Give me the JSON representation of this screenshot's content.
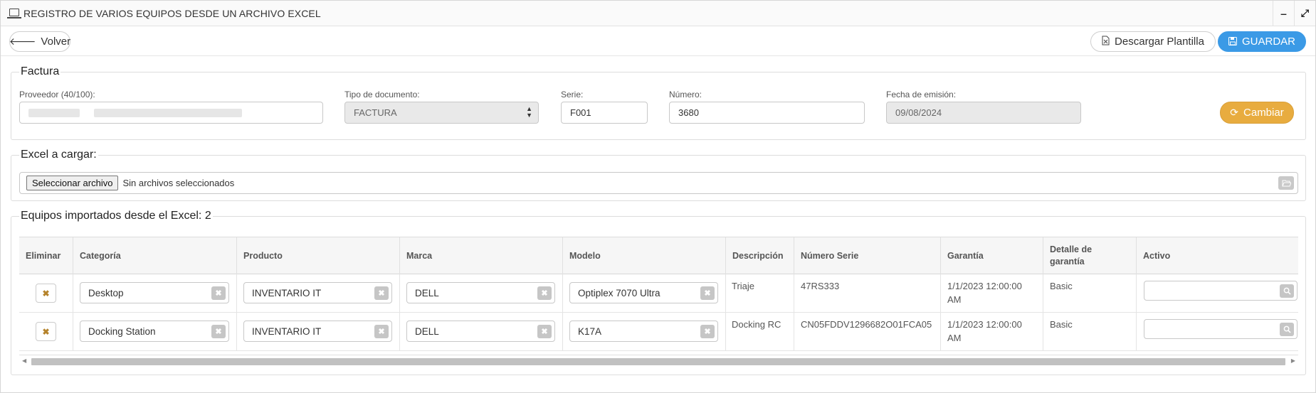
{
  "window": {
    "title": "REGISTRO DE VARIOS EQUIPOS DESDE UN ARCHIVO EXCEL",
    "minimize_glyph": "‒",
    "maximize_glyph": "⤢"
  },
  "toolbar": {
    "back_label": "Volver",
    "download_label": "Descargar Plantilla",
    "save_label": "GUARDAR"
  },
  "factura": {
    "legend": "Factura",
    "proveedor_label": "Proveedor (40/100):",
    "tipo_label": "Tipo de documento:",
    "tipo_value": "FACTURA",
    "serie_label": "Serie:",
    "serie_value": "F001",
    "numero_label": "Número:",
    "numero_value": "3680",
    "fecha_label": "Fecha de emisión:",
    "fecha_value": "09/08/2024",
    "cambiar_label": "Cambiar"
  },
  "excel": {
    "legend": "Excel a cargar:",
    "file_button": "Seleccionar archivo",
    "file_status": "Sin archivos seleccionados"
  },
  "equipos": {
    "legend": "Equipos importados desde el Excel: 2",
    "columns": [
      "Eliminar",
      "Categoría",
      "Producto",
      "Marca",
      "Modelo",
      "Descripción",
      "Número Serie",
      "Garantía",
      "Detalle de garantía",
      "Activo"
    ],
    "rows": [
      {
        "categoria": "Desktop",
        "producto": "INVENTARIO IT",
        "marca": "DELL",
        "modelo": "Optiplex 7070 Ultra",
        "descripcion": "Triaje",
        "numero_serie": "47RS333",
        "garantia": "1/1/2023 12:00:00 AM",
        "detalle": "Basic",
        "activo": ""
      },
      {
        "categoria": "Docking Station",
        "producto": "INVENTARIO IT",
        "marca": "DELL",
        "modelo": "K17A",
        "descripcion": "Docking RC",
        "numero_serie": "CN05FDDV1296682O01FCA05",
        "garantia": "1/1/2023 12:00:00 AM",
        "detalle": "Basic",
        "activo": ""
      }
    ]
  },
  "colors": {
    "primary": "#3b9ae6",
    "warning": "#e8ac3f",
    "delete_icon": "#b5832c"
  },
  "icons": [
    "laptop-icon",
    "minimize-icon",
    "maximize-icon",
    "arrow-left-icon",
    "excel-file-icon",
    "floppy-icon",
    "refresh-icon",
    "folder-open-icon",
    "close-icon",
    "search-icon"
  ]
}
